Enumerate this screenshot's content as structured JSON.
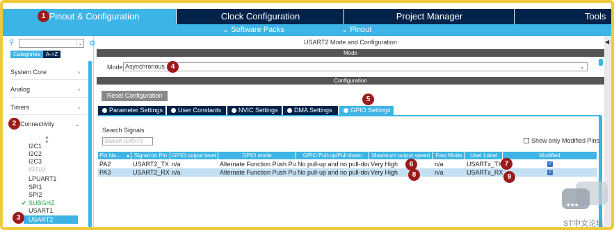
{
  "top_tabs": {
    "pinout": "Pinout & Configuration",
    "clock": "Clock Configuration",
    "project": "Project Manager",
    "tools": "Tools"
  },
  "sub_bar": {
    "software_packs": "Software Packs",
    "pinout": "Pinout"
  },
  "left": {
    "categories_tab": "Categories",
    "az_tab": "A->Z",
    "categories": [
      "System Core",
      "Analog",
      "Timers",
      "Connectivity"
    ],
    "peripherals": {
      "i2c1": "I2C1",
      "i2c2": "I2C2",
      "i2c3": "I2C3",
      "irtim": "IRTIM",
      "lpuart1": "LPUART1",
      "spi1": "SPI1",
      "spi2": "SPI2",
      "subghz": "SUBGHZ",
      "usart1": "USART1",
      "usart2": "USART2"
    }
  },
  "right": {
    "title": "USART2 Mode and Configuration",
    "mode_band": "Mode",
    "mode_label": "Mode",
    "mode_value": "Asynchronous",
    "config_band": "Configuration",
    "reset_button": "Reset Configuration",
    "tabs": [
      "Parameter Settings",
      "User Constants",
      "NVIC Settings",
      "DMA Settings",
      "GPIO Settings"
    ],
    "search_label": "Search Signals",
    "search_placeholder": "Search (Crtl+F)",
    "show_modified": "Show only Modified Pins",
    "columns": [
      "Pin Na...",
      "Signal on Pin",
      "GPIO output level",
      "GPIO mode",
      "GPIO Pull-up/Pull-down",
      "Maximum output speed",
      "Fast Mode",
      "User Label",
      "Modified"
    ],
    "rows": [
      {
        "pin": "PA2",
        "signal": "USART2_TX",
        "level": "n/a",
        "mode": "Alternate Function Push Pull",
        "pull": "No pull-up and no pull-down",
        "speed": "Very High",
        "fast": "n/a",
        "label": "USARTx_TX",
        "modified": true
      },
      {
        "pin": "PA3",
        "signal": "USART2_RX",
        "level": "n/a",
        "mode": "Alternate Function Push Pull",
        "pull": "No pull-up and no pull-down",
        "speed": "Very High",
        "fast": "n/a",
        "label": "USARTx_RX",
        "modified": true
      }
    ]
  },
  "badges": [
    "1",
    "2",
    "3",
    "4",
    "5",
    "6",
    "7",
    "8",
    "9"
  ],
  "watermark": "ST中文论坛",
  "colors": {
    "accent": "#3cb4e5",
    "navy": "#03234b",
    "badge": "#9b1b1b",
    "ok": "#2ea84a"
  }
}
